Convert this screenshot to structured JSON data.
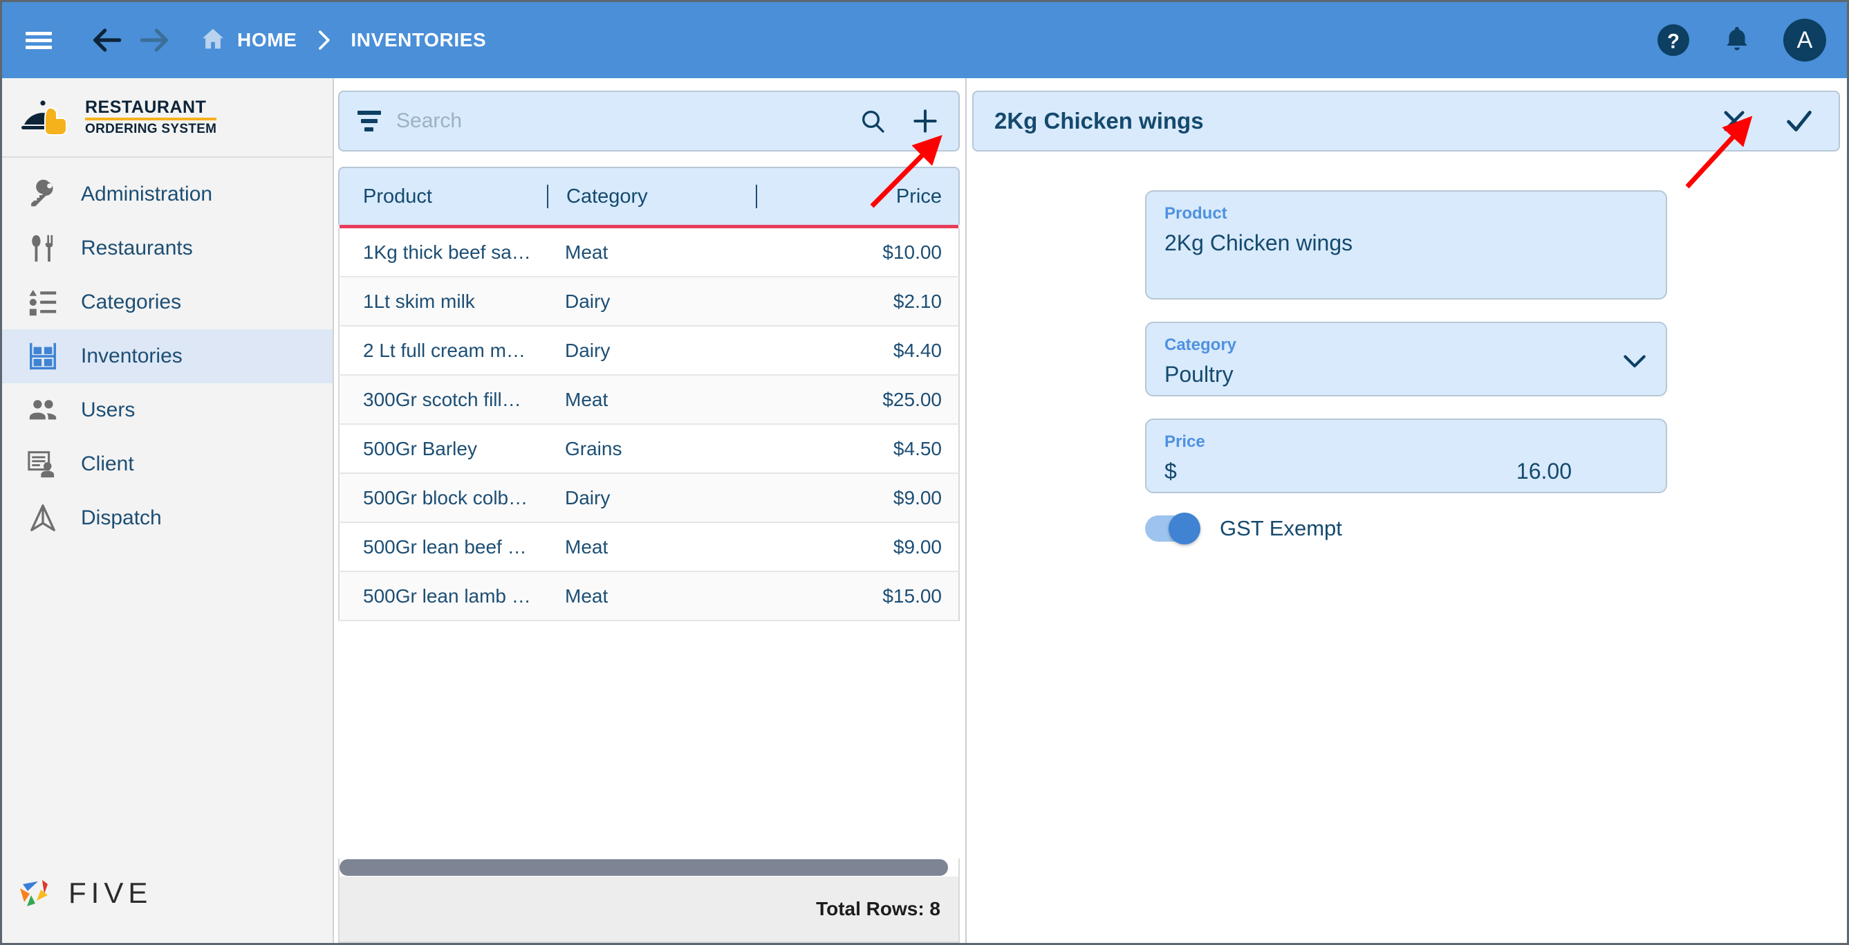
{
  "topbar": {
    "menu_icon": "hamburger-menu-icon",
    "back_icon": "arrow-back-icon",
    "forward_icon": "arrow-forward-icon",
    "home_icon": "home-icon",
    "home_label": "HOME",
    "separator_icon": "chevron-right-icon",
    "current_crumb": "INVENTORIES",
    "help_icon": "help-circle-icon",
    "notifications_icon": "bell-icon",
    "avatar_initial": "A",
    "bg_color": "#4a8fd8",
    "accent_dark": "#0d3f63"
  },
  "sidebar": {
    "logo": {
      "line1": "RESTAURANT",
      "line2": "ORDERING SYSTEM",
      "icon": "cloche-hand-logo-icon",
      "underline_color": "#f5b21c"
    },
    "items": [
      {
        "label": "Administration",
        "icon": "key-icon",
        "selected": false
      },
      {
        "label": "Restaurants",
        "icon": "cutlery-icon",
        "selected": false
      },
      {
        "label": "Categories",
        "icon": "category-list-icon",
        "selected": false
      },
      {
        "label": "Inventories",
        "icon": "shelf-icon",
        "selected": true
      },
      {
        "label": "Users",
        "icon": "people-icon",
        "selected": false
      },
      {
        "label": "Client",
        "icon": "document-person-icon",
        "selected": false
      },
      {
        "label": "Dispatch",
        "icon": "paper-plane-icon",
        "selected": false
      }
    ],
    "footer_logo": {
      "word": "FIVE",
      "icon": "five-pinwheel-icon",
      "colors": [
        "#3b7dd8",
        "#e0352b",
        "#f6bd20",
        "#35a853",
        "#f58220"
      ]
    }
  },
  "list_pane": {
    "search": {
      "placeholder": "Search",
      "value": "",
      "filter_icon": "filter-icon",
      "search_icon": "search-icon",
      "add_icon": "plus-icon"
    },
    "columns": [
      "Product",
      "Category",
      "Price"
    ],
    "rows": [
      {
        "product": "1Kg thick beef sa…",
        "category": "Meat",
        "price": "$10.00"
      },
      {
        "product": "1Lt skim milk",
        "category": "Dairy",
        "price": "$2.10"
      },
      {
        "product": "2 Lt full cream m…",
        "category": "Dairy",
        "price": "$4.40"
      },
      {
        "product": "300Gr scotch fill…",
        "category": "Meat",
        "price": "$25.00"
      },
      {
        "product": "500Gr Barley",
        "category": "Grains",
        "price": "$4.50"
      },
      {
        "product": "500Gr block colb…",
        "category": "Dairy",
        "price": "$9.00"
      },
      {
        "product": "500Gr lean beef …",
        "category": "Meat",
        "price": "$9.00"
      },
      {
        "product": "500Gr lean lamb …",
        "category": "Meat",
        "price": "$15.00"
      }
    ],
    "total_rows_label": "Total Rows: 8",
    "header_underline_color": "#e83e5c"
  },
  "detail_pane": {
    "title": "2Kg Chicken wings",
    "close_icon": "close-x-icon",
    "save_icon": "checkmark-icon",
    "fields": {
      "product": {
        "label": "Product",
        "value": "2Kg Chicken wings"
      },
      "category": {
        "label": "Category",
        "value": "Poultry",
        "chevron_icon": "chevron-down-icon"
      },
      "price": {
        "label": "Price",
        "currency": "$",
        "value": "16.00"
      }
    },
    "toggle": {
      "label": "GST Exempt",
      "on": true
    }
  },
  "annotations": {
    "arrow_color": "#ff0000",
    "arrow_add_button": "red-arrow-pointing-to-add-button",
    "arrow_save_button": "red-arrow-pointing-to-save-button"
  }
}
